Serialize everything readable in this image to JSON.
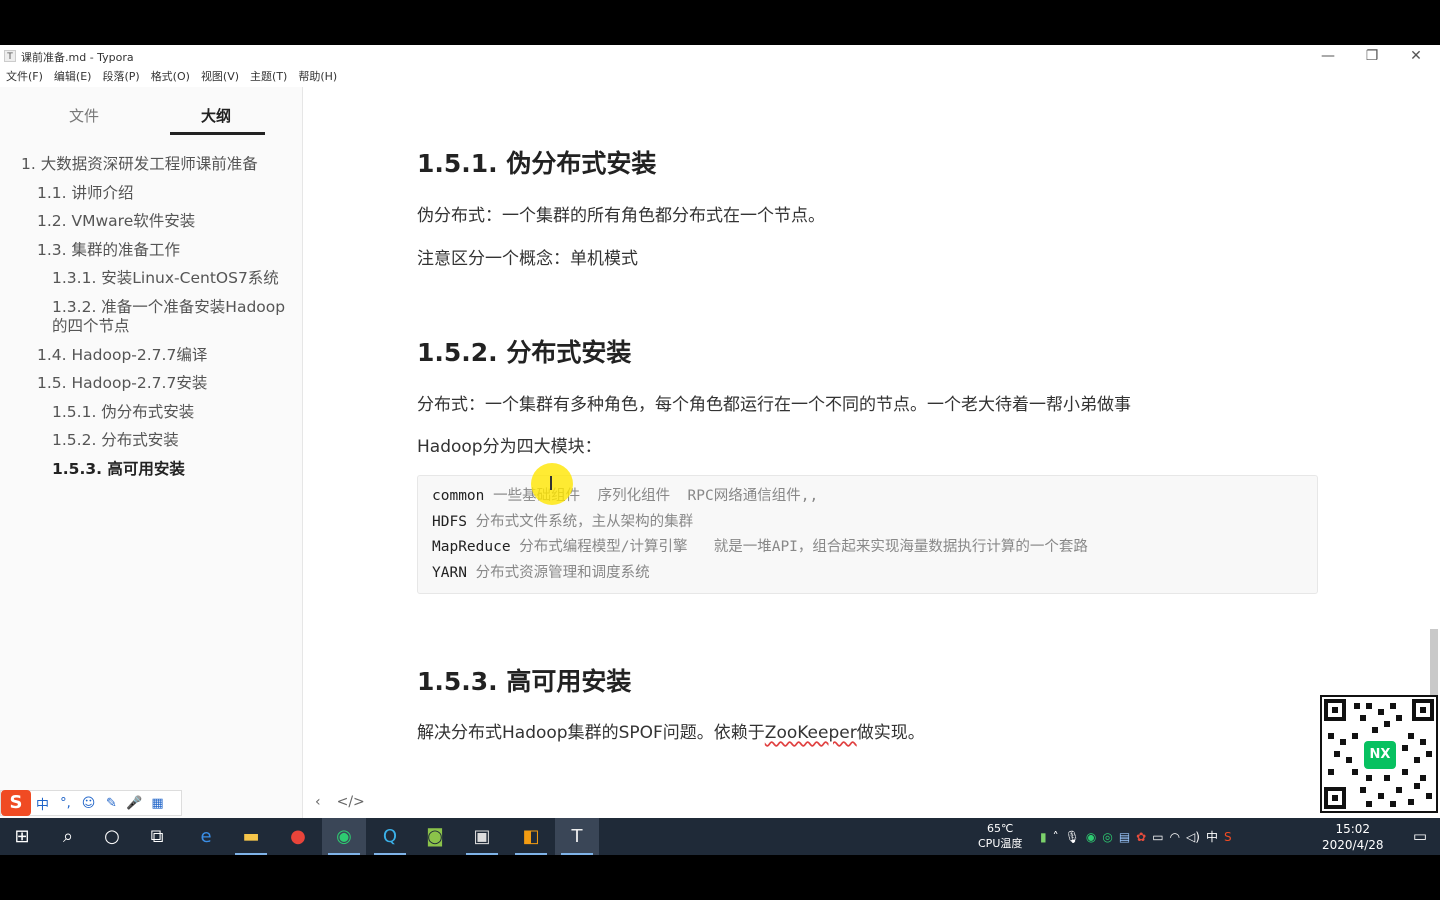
{
  "window": {
    "title": "课前准备.md - Typora",
    "app_icon": "T",
    "controls": {
      "minimize": "—",
      "maximize": "❐",
      "close": "✕"
    }
  },
  "menu": [
    "文件(F)",
    "编辑(E)",
    "段落(P)",
    "格式(O)",
    "视图(V)",
    "主题(T)",
    "帮助(H)"
  ],
  "sidebar": {
    "tabs": {
      "files": "文件",
      "outline": "大纲"
    },
    "outline": [
      {
        "label": "1. 大数据资深研发工程师课前准备",
        "level": 1
      },
      {
        "label": "1.1. 讲师介绍",
        "level": 2
      },
      {
        "label": "1.2. VMware软件安装",
        "level": 2
      },
      {
        "label": "1.3. 集群的准备工作",
        "level": 2
      },
      {
        "label": "1.3.1. 安装Linux-CentOS7系统",
        "level": 3
      },
      {
        "label": "1.3.2. 准备一个准备安装Hadoop",
        "label2": "的四个节点",
        "level": 3
      },
      {
        "label": "1.4. Hadoop-2.7.7编译",
        "level": 2
      },
      {
        "label": "1.5. Hadoop-2.7.7安装",
        "level": 2
      },
      {
        "label": "1.5.1. 伪分布式安装",
        "level": 3
      },
      {
        "label": "1.5.2. 分布式安装",
        "level": 3
      },
      {
        "label": "1.5.3. 高可用安装",
        "level": 3,
        "active": true
      }
    ]
  },
  "content": {
    "h_151": "1.5.1. 伪分布式安装",
    "p_151_a": "伪分布式：一个集群的所有角色都分布式在一个节点。",
    "p_151_b": "注意区分一个概念：单机模式",
    "h_152": "1.5.2. 分布式安装",
    "p_152_a": "分布式：一个集群有多种角色，每个角色都运行在一个不同的节点。一个老大待着一帮小弟做事",
    "p_152_b": "Hadoop分为四大模块：",
    "code": [
      {
        "kw": "common",
        "text": " 一些基础组件  序列化组件  RPC网络通信组件,,"
      },
      {
        "kw": "HDFS",
        "text": " 分布式文件系统，主从架构的集群"
      },
      {
        "kw": "MapReduce",
        "text": " 分布式编程模型/计算引擎   就是一堆API，组合起来实现海量数据执行计算的一个套路"
      },
      {
        "kw": "YARN",
        "text": " 分布式资源管理和调度系统"
      }
    ],
    "h_153": "1.5.3. 高可用安装",
    "p_153_pre": "解决分布式Hadoop集群的SPOF问题。依赖于",
    "p_153_link": "ZooKeeper",
    "p_153_post": "做实现。"
  },
  "bottom_controls": {
    "back": "‹",
    "source": "</>"
  },
  "ime": {
    "logo": "S",
    "buttons": [
      "中",
      "°,",
      "☺",
      "✎",
      "🎤",
      "▦"
    ]
  },
  "qr": {
    "center_label": "NX"
  },
  "taskbar": {
    "icons": [
      "start-icon",
      "search-icon",
      "cortana-icon",
      "task-view-icon",
      "edge-icon",
      "file-explorer-icon",
      "chrome-icon",
      "wechat-icon",
      "search-tool-icon",
      "app-icon",
      "vm-icon",
      "sublime-icon",
      "typora-icon"
    ],
    "temp": "65℃",
    "temp_label": "CPU温度",
    "ime_lang": "中",
    "time": "15:02",
    "date": "2020/4/28"
  }
}
